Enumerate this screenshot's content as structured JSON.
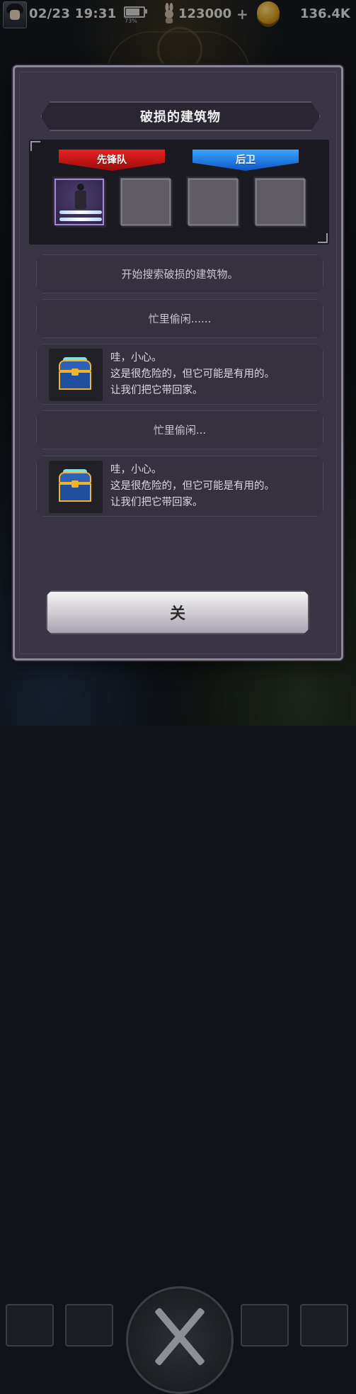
{
  "status_bar": {
    "datetime": "02/23 19:31",
    "battery_percent": "73%",
    "battery_level": 0.73,
    "currency_1": "123000",
    "currency_2": "136.4K"
  },
  "modal": {
    "title": "破损的建筑物",
    "team": {
      "front_label": "先锋队",
      "back_label": "后卫"
    },
    "logs": [
      {
        "type": "text",
        "text": "开始搜索破损的建筑物。"
      },
      {
        "type": "text",
        "text": "忙里偷闲......"
      },
      {
        "type": "chest",
        "lines": [
          "哇，小心。",
          "这是很危险的，但它可能是有用的。",
          "让我们把它带回家。"
        ]
      },
      {
        "type": "text",
        "text": "忙里偷闲..."
      },
      {
        "type": "chest",
        "lines": [
          "哇，小心。",
          "这是很危险的，但它可能是有用的。",
          "让我们把它带回家。"
        ]
      }
    ],
    "close_label": "关"
  },
  "icons": {
    "avatar": "hero-avatar",
    "battery": "battery-icon",
    "currency_1": "bunny-icon",
    "currency_2": "gold-coin-icon",
    "chest": "treasure-chest-icon"
  }
}
